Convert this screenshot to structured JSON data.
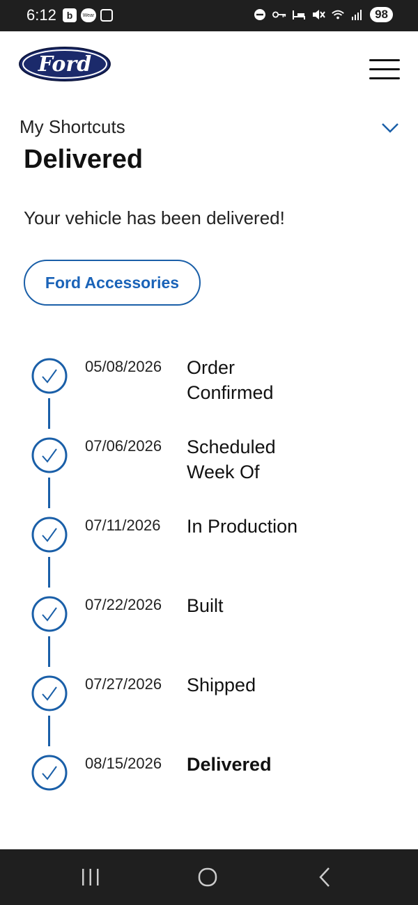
{
  "status_bar": {
    "time": "6:12",
    "left_badge": "b",
    "wear_badge": "Wear",
    "battery": "98"
  },
  "header": {
    "brand": "Ford",
    "brand_color": "#1b2a6b"
  },
  "shortcuts": {
    "label": "My Shortcuts"
  },
  "page": {
    "heading": "Delivered",
    "message": "Your vehicle has been delivered!",
    "accessories_button": "Ford Accessories",
    "accent_color": "#1a5fa8"
  },
  "timeline": [
    {
      "date": "05/08/2026",
      "label": "Order Confirmed",
      "current": false
    },
    {
      "date": "07/06/2026",
      "label": "Scheduled Week Of",
      "current": false
    },
    {
      "date": "07/11/2026",
      "label": "In Production",
      "current": false
    },
    {
      "date": "07/22/2026",
      "label": "Built",
      "current": false
    },
    {
      "date": "07/27/2026",
      "label": "Shipped",
      "current": false
    },
    {
      "date": "08/15/2026",
      "label": "Delivered",
      "current": true
    }
  ]
}
